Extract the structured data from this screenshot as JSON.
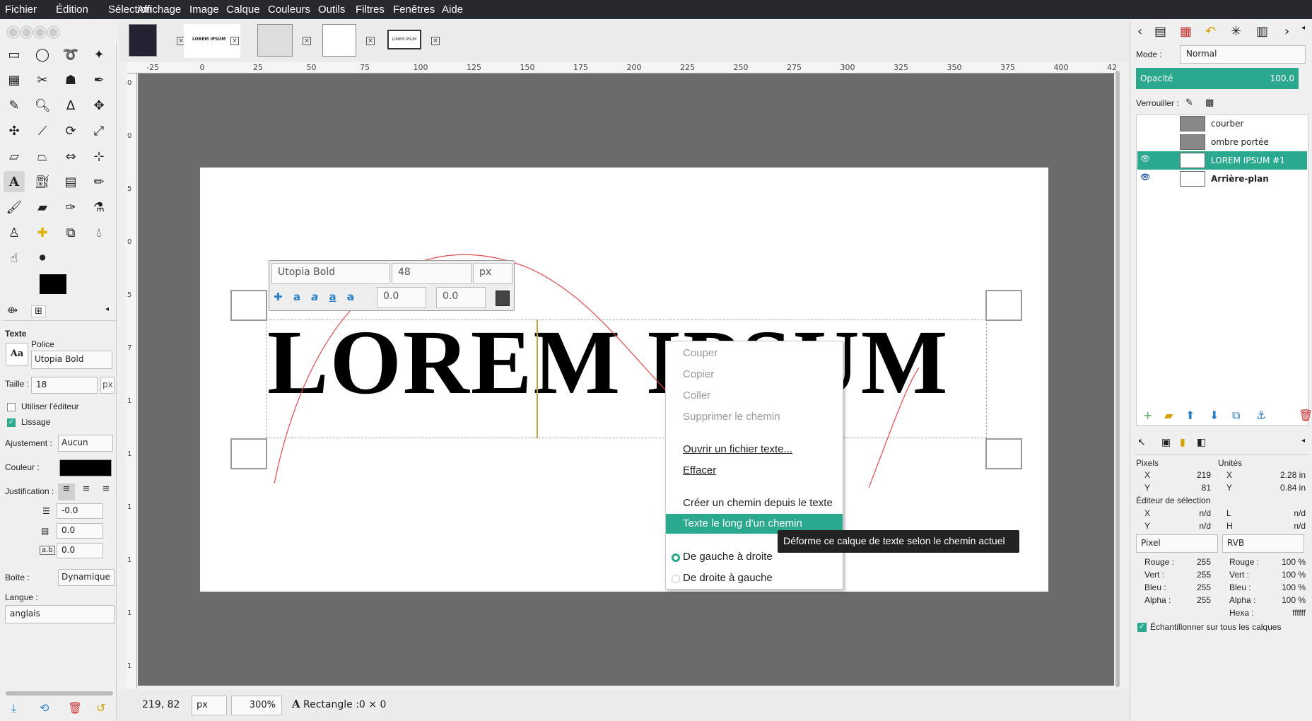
{
  "menu": [
    "Fichier",
    "Édition",
    "Sélection",
    "Affichage",
    "Image",
    "Calque",
    "Couleurs",
    "Outils",
    "Filtres",
    "Fenêtres",
    "Aide"
  ],
  "tabs": [
    {
      "label": "LOREM IPSUM"
    },
    {
      "label": "LOREM IPSUM"
    }
  ],
  "ruler": {
    "h": [
      "-25",
      "0",
      "25",
      "50",
      "75",
      "100",
      "125",
      "150",
      "175",
      "200",
      "225",
      "250",
      "275",
      "300",
      "325",
      "350",
      "375",
      "400",
      "42"
    ],
    "v": [
      "0",
      "0",
      "5",
      "0",
      "5",
      "7",
      "1",
      "1",
      "1",
      "1",
      "1",
      "1"
    ]
  },
  "canvas": {
    "text": "LOREM IPSUM"
  },
  "text_toolbar": {
    "font": "Utopia Bold",
    "size": "48",
    "unit": "px",
    "baseline": "0.0",
    "kerning": "0.0"
  },
  "context_menu": {
    "items": [
      "Couper",
      "Copier",
      "Coller",
      "Supprimer le chemin",
      "Ouvrir un fichier texte...",
      "Effacer",
      "Créer un chemin depuis le texte",
      "Texte le long d'un chemin",
      "De gauche à droite",
      "De droite à gauche"
    ],
    "tooltip": "Déforme ce calque de texte selon le chemin actuel"
  },
  "tool_options": {
    "title": "Texte",
    "font_label": "Police",
    "font_value": "Utopia Bold",
    "size_label": "Taille :",
    "size_value": "18",
    "size_unit": "px",
    "use_editor": "Utiliser l'éditeur",
    "antialias": "Lissage",
    "hinting_label": "Ajustement :",
    "hinting_value": "Aucun",
    "color_label": "Couleur :",
    "justify_label": "Justification :",
    "indent": "-0.0",
    "line_spacing": "0.0",
    "letter_spacing": "0.0",
    "box_label": "Boîte :",
    "box_value": "Dynamique",
    "lang_label": "Langue :",
    "lang_value": "anglais",
    "aa_icon": "Aa"
  },
  "layers": {
    "mode_label": "Mode :",
    "mode_value": "Normal",
    "opacity_label": "Opacité",
    "opacity_value": "100.0",
    "lock_label": "Verrouiller :",
    "items": [
      {
        "name": "courber"
      },
      {
        "name": "ombre portée"
      },
      {
        "name": "LOREM IPSUM #1"
      },
      {
        "name": "Arrière-plan"
      }
    ]
  },
  "pointer": {
    "pixels_label": "Pixels",
    "units_label": "Unités",
    "x_label": "X",
    "y_label": "Y",
    "px_x": "219",
    "px_y": "81",
    "u_x": "2.28 in",
    "u_y": "0.84 in",
    "sel_editor": "Éditeur de sélection",
    "sel_x": "n/d",
    "sel_y": "n/d",
    "l_label": "L",
    "h_label": "H",
    "sel_l": "n/d",
    "sel_h": "n/d",
    "pixel_dd": "Pixel",
    "rvb_dd": "RVB",
    "rows": [
      {
        "l": "Rouge :",
        "v": "255",
        "l2": "Rouge :",
        "v2": "100 %"
      },
      {
        "l": "Vert :",
        "v": "255",
        "l2": "Vert :",
        "v2": "100 %"
      },
      {
        "l": "Bleu :",
        "v": "255",
        "l2": "Bleu :",
        "v2": "100 %"
      },
      {
        "l": "Alpha :",
        "v": "255",
        "l2": "Alpha :",
        "v2": "100 %"
      }
    ],
    "hexa_label": "Hexa :",
    "hexa_value": "ffffff",
    "sample_all": "Échantillonner sur tous les calques"
  },
  "status": {
    "coords": "219, 82",
    "unit": "px",
    "zoom": "300%",
    "message": "Rectangle :0 × 0"
  },
  "colors": {
    "accent": "#2aa98f",
    "menubar": "#262a2d",
    "canvas_bg": "#6c6c6c"
  }
}
